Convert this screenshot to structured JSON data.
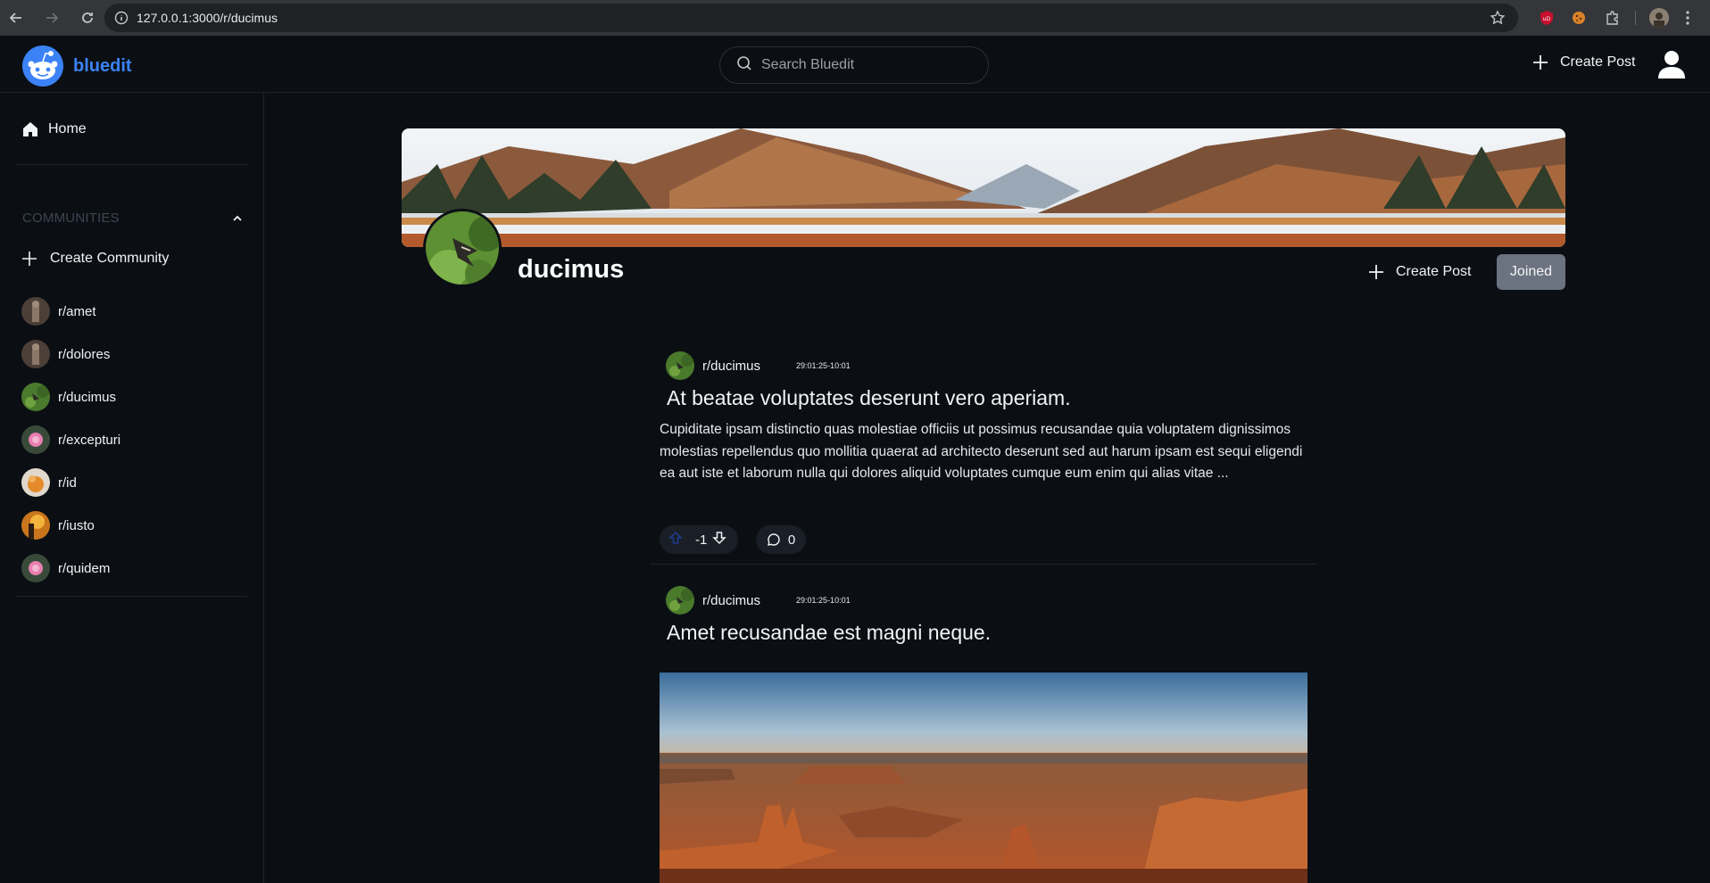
{
  "browser": {
    "url": "127.0.0.1:3000/r/ducimus"
  },
  "header": {
    "brand": "bluedit",
    "search_placeholder": "Search Bluedit",
    "create_post_label": "Create Post"
  },
  "sidebar": {
    "home_label": "Home",
    "communities_header": "COMMUNITIES",
    "create_community_label": "Create Community",
    "communities": [
      {
        "label": "r/amet",
        "avatar": "statue-avatar"
      },
      {
        "label": "r/dolores",
        "avatar": "statue-avatar"
      },
      {
        "label": "r/ducimus",
        "avatar": "butterfly-avatar"
      },
      {
        "label": "r/excepturi",
        "avatar": "flower-avatar"
      },
      {
        "label": "r/id",
        "avatar": "orange-avatar"
      },
      {
        "label": "r/iusto",
        "avatar": "sunset-avatar"
      },
      {
        "label": "r/quidem",
        "avatar": "flower-avatar"
      }
    ]
  },
  "community": {
    "name": "ducimus",
    "create_post_label": "Create Post",
    "joined_label": "Joined"
  },
  "posts": [
    {
      "subreddit": "r/ducimus",
      "timestamp": "29:01:25-10:01",
      "title": "At beatae voluptates deserunt vero aperiam.",
      "body": "Cupiditate ipsam distinctio quas molestiae officiis ut possimus recusandae quia voluptatem dignissimos molestias repellendus quo mollitia quaerat ad architecto deserunt sed aut harum ipsam est sequi eligendi ea aut iste et laborum nulla qui dolores aliquid voluptates cumque eum enim qui alias vitae ...",
      "score": "-1",
      "comments": "0"
    },
    {
      "subreddit": "r/ducimus",
      "timestamp": "29:01:25-10:01",
      "title": "Amet recusandae est magni neque."
    }
  ],
  "colors": {
    "background": "#0b0f14",
    "brand": "#3b82f6",
    "joined_button": "#6b7280"
  }
}
